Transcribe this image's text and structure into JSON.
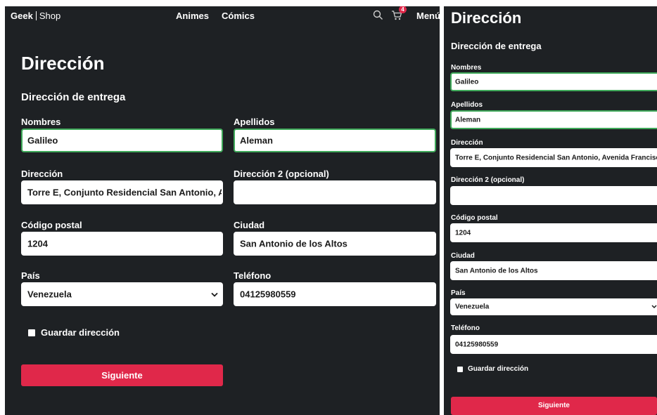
{
  "nav": {
    "brand_bold": "Geek",
    "brand_rest": "Shop",
    "links": [
      "Animes",
      "Cómics"
    ],
    "cart_count": "4",
    "menu_label": "Menú",
    "icons": [
      "search-icon",
      "cart-icon"
    ]
  },
  "page": {
    "title": "Dirección",
    "subtitle": "Dirección de entrega"
  },
  "form": {
    "nombres": {
      "label": "Nombres",
      "value": "Galileo"
    },
    "apellidos": {
      "label": "Apellidos",
      "value": "Aleman"
    },
    "direccion": {
      "label": "Dirección",
      "value": "Torre E, Conjunto Residencial San Antonio, Avenida Francisco"
    },
    "direccion2": {
      "label": "Dirección 2 (opcional)",
      "value": ""
    },
    "codigo_postal": {
      "label": "Código postal",
      "value": "1204"
    },
    "ciudad": {
      "label": "Ciudad",
      "value": "San Antonio de los Altos"
    },
    "pais": {
      "label": "País",
      "value": "Venezuela"
    },
    "telefono": {
      "label": "Teléfono",
      "value": "04125980559"
    },
    "guardar_label": "Guardar dirección",
    "submit_label": "Siguiente"
  },
  "colors": {
    "background": "#1e2124",
    "accent": "#e0284a",
    "valid_border": "#3fa95a"
  }
}
